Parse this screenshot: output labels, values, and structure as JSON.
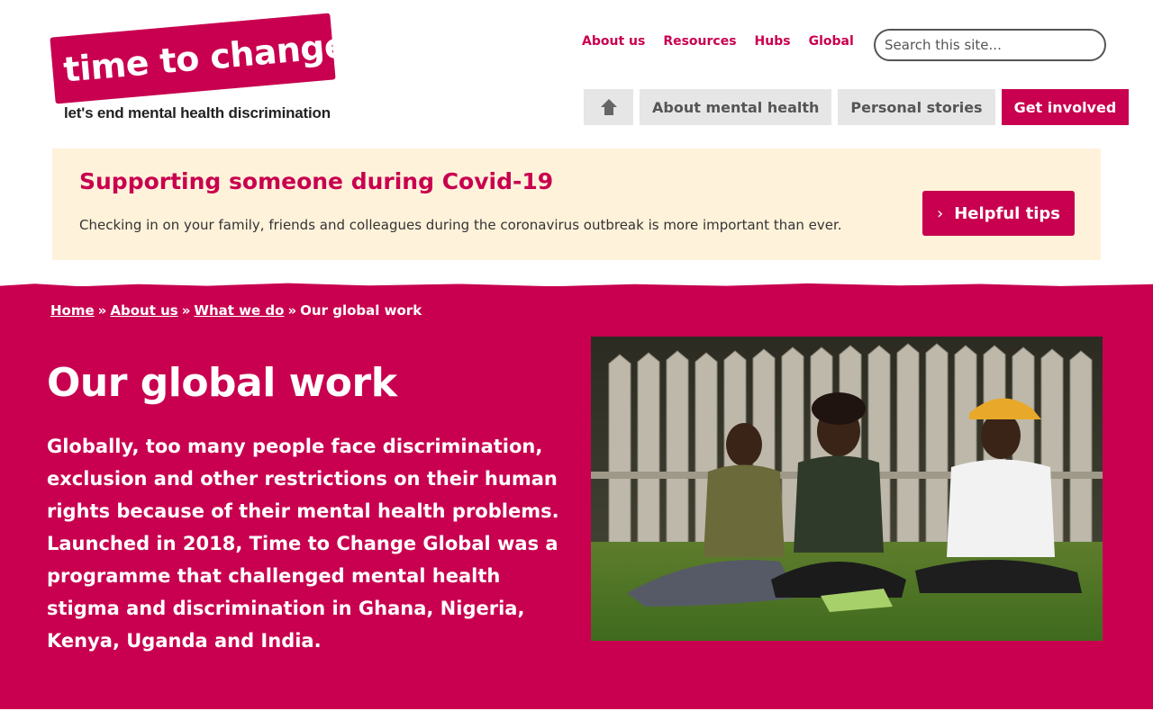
{
  "logo": {
    "wordmark": "time to change",
    "tagline": "let's end mental health discrimination"
  },
  "topnav": [
    "About us",
    "Resources",
    "Hubs",
    "Global"
  ],
  "search": {
    "placeholder": "Search this site..."
  },
  "mainnav": {
    "home_icon": "home-icon",
    "items": [
      "About mental health",
      "Personal stories",
      "Get involved"
    ]
  },
  "banner": {
    "title": "Supporting someone during Covid-19",
    "text": "Checking in on your family, friends and colleagues during the coronavirus outbreak is more important than ever.",
    "button": "Helpful tips"
  },
  "breadcrumb": {
    "items": [
      "Home",
      "About us",
      "What we do"
    ],
    "current": "Our global work",
    "separator": "»"
  },
  "hero": {
    "title": "Our global work",
    "text": "Globally, too many people face discrimination, exclusion and other restrictions on their human rights because of their mental health problems. Launched in 2018, Time to Change Global was a programme that challenged mental health stigma and discrimination in Ghana, Nigeria, Kenya, Uganda and India."
  },
  "colors": {
    "brand": "#c8004f",
    "banner_bg": "#fff2da",
    "nav_bg": "#e6e6e6"
  }
}
